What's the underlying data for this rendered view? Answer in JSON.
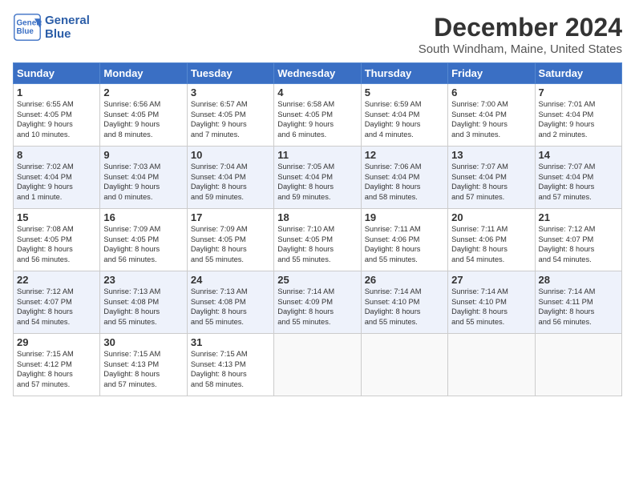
{
  "header": {
    "logo_line1": "General",
    "logo_line2": "Blue",
    "title": "December 2024",
    "location": "South Windham, Maine, United States"
  },
  "weekdays": [
    "Sunday",
    "Monday",
    "Tuesday",
    "Wednesday",
    "Thursday",
    "Friday",
    "Saturday"
  ],
  "weeks": [
    [
      {
        "day": "1",
        "lines": [
          "Sunrise: 6:55 AM",
          "Sunset: 4:05 PM",
          "Daylight: 9 hours",
          "and 10 minutes."
        ]
      },
      {
        "day": "2",
        "lines": [
          "Sunrise: 6:56 AM",
          "Sunset: 4:05 PM",
          "Daylight: 9 hours",
          "and 8 minutes."
        ]
      },
      {
        "day": "3",
        "lines": [
          "Sunrise: 6:57 AM",
          "Sunset: 4:05 PM",
          "Daylight: 9 hours",
          "and 7 minutes."
        ]
      },
      {
        "day": "4",
        "lines": [
          "Sunrise: 6:58 AM",
          "Sunset: 4:05 PM",
          "Daylight: 9 hours",
          "and 6 minutes."
        ]
      },
      {
        "day": "5",
        "lines": [
          "Sunrise: 6:59 AM",
          "Sunset: 4:04 PM",
          "Daylight: 9 hours",
          "and 4 minutes."
        ]
      },
      {
        "day": "6",
        "lines": [
          "Sunrise: 7:00 AM",
          "Sunset: 4:04 PM",
          "Daylight: 9 hours",
          "and 3 minutes."
        ]
      },
      {
        "day": "7",
        "lines": [
          "Sunrise: 7:01 AM",
          "Sunset: 4:04 PM",
          "Daylight: 9 hours",
          "and 2 minutes."
        ]
      }
    ],
    [
      {
        "day": "8",
        "lines": [
          "Sunrise: 7:02 AM",
          "Sunset: 4:04 PM",
          "Daylight: 9 hours",
          "and 1 minute."
        ]
      },
      {
        "day": "9",
        "lines": [
          "Sunrise: 7:03 AM",
          "Sunset: 4:04 PM",
          "Daylight: 9 hours",
          "and 0 minutes."
        ]
      },
      {
        "day": "10",
        "lines": [
          "Sunrise: 7:04 AM",
          "Sunset: 4:04 PM",
          "Daylight: 8 hours",
          "and 59 minutes."
        ]
      },
      {
        "day": "11",
        "lines": [
          "Sunrise: 7:05 AM",
          "Sunset: 4:04 PM",
          "Daylight: 8 hours",
          "and 59 minutes."
        ]
      },
      {
        "day": "12",
        "lines": [
          "Sunrise: 7:06 AM",
          "Sunset: 4:04 PM",
          "Daylight: 8 hours",
          "and 58 minutes."
        ]
      },
      {
        "day": "13",
        "lines": [
          "Sunrise: 7:07 AM",
          "Sunset: 4:04 PM",
          "Daylight: 8 hours",
          "and 57 minutes."
        ]
      },
      {
        "day": "14",
        "lines": [
          "Sunrise: 7:07 AM",
          "Sunset: 4:04 PM",
          "Daylight: 8 hours",
          "and 57 minutes."
        ]
      }
    ],
    [
      {
        "day": "15",
        "lines": [
          "Sunrise: 7:08 AM",
          "Sunset: 4:05 PM",
          "Daylight: 8 hours",
          "and 56 minutes."
        ]
      },
      {
        "day": "16",
        "lines": [
          "Sunrise: 7:09 AM",
          "Sunset: 4:05 PM",
          "Daylight: 8 hours",
          "and 56 minutes."
        ]
      },
      {
        "day": "17",
        "lines": [
          "Sunrise: 7:09 AM",
          "Sunset: 4:05 PM",
          "Daylight: 8 hours",
          "and 55 minutes."
        ]
      },
      {
        "day": "18",
        "lines": [
          "Sunrise: 7:10 AM",
          "Sunset: 4:05 PM",
          "Daylight: 8 hours",
          "and 55 minutes."
        ]
      },
      {
        "day": "19",
        "lines": [
          "Sunrise: 7:11 AM",
          "Sunset: 4:06 PM",
          "Daylight: 8 hours",
          "and 55 minutes."
        ]
      },
      {
        "day": "20",
        "lines": [
          "Sunrise: 7:11 AM",
          "Sunset: 4:06 PM",
          "Daylight: 8 hours",
          "and 54 minutes."
        ]
      },
      {
        "day": "21",
        "lines": [
          "Sunrise: 7:12 AM",
          "Sunset: 4:07 PM",
          "Daylight: 8 hours",
          "and 54 minutes."
        ]
      }
    ],
    [
      {
        "day": "22",
        "lines": [
          "Sunrise: 7:12 AM",
          "Sunset: 4:07 PM",
          "Daylight: 8 hours",
          "and 54 minutes."
        ]
      },
      {
        "day": "23",
        "lines": [
          "Sunrise: 7:13 AM",
          "Sunset: 4:08 PM",
          "Daylight: 8 hours",
          "and 55 minutes."
        ]
      },
      {
        "day": "24",
        "lines": [
          "Sunrise: 7:13 AM",
          "Sunset: 4:08 PM",
          "Daylight: 8 hours",
          "and 55 minutes."
        ]
      },
      {
        "day": "25",
        "lines": [
          "Sunrise: 7:14 AM",
          "Sunset: 4:09 PM",
          "Daylight: 8 hours",
          "and 55 minutes."
        ]
      },
      {
        "day": "26",
        "lines": [
          "Sunrise: 7:14 AM",
          "Sunset: 4:10 PM",
          "Daylight: 8 hours",
          "and 55 minutes."
        ]
      },
      {
        "day": "27",
        "lines": [
          "Sunrise: 7:14 AM",
          "Sunset: 4:10 PM",
          "Daylight: 8 hours",
          "and 55 minutes."
        ]
      },
      {
        "day": "28",
        "lines": [
          "Sunrise: 7:14 AM",
          "Sunset: 4:11 PM",
          "Daylight: 8 hours",
          "and 56 minutes."
        ]
      }
    ],
    [
      {
        "day": "29",
        "lines": [
          "Sunrise: 7:15 AM",
          "Sunset: 4:12 PM",
          "Daylight: 8 hours",
          "and 57 minutes."
        ]
      },
      {
        "day": "30",
        "lines": [
          "Sunrise: 7:15 AM",
          "Sunset: 4:13 PM",
          "Daylight: 8 hours",
          "and 57 minutes."
        ]
      },
      {
        "day": "31",
        "lines": [
          "Sunrise: 7:15 AM",
          "Sunset: 4:13 PM",
          "Daylight: 8 hours",
          "and 58 minutes."
        ]
      },
      {
        "day": "",
        "lines": []
      },
      {
        "day": "",
        "lines": []
      },
      {
        "day": "",
        "lines": []
      },
      {
        "day": "",
        "lines": []
      }
    ]
  ]
}
